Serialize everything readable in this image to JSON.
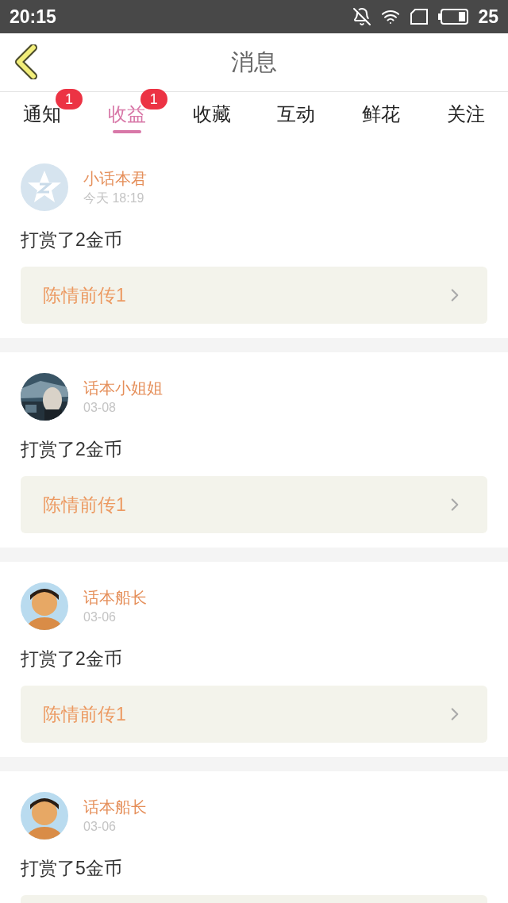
{
  "status_bar": {
    "time": "20:15",
    "battery": "25"
  },
  "header": {
    "title": "消息"
  },
  "tabs": [
    {
      "label": "通知",
      "selected": false,
      "badge": "1"
    },
    {
      "label": "收益",
      "selected": true,
      "badge": "1"
    },
    {
      "label": "收藏",
      "selected": false
    },
    {
      "label": "互动",
      "selected": false
    },
    {
      "label": "鲜花",
      "selected": false
    },
    {
      "label": "关注",
      "selected": false
    }
  ],
  "messages": [
    {
      "avatar": {
        "kind": "star"
      },
      "name": "小话本君",
      "time": "今天 18:19",
      "text": "打赏了2金币",
      "link": "陈情前传1"
    },
    {
      "name": "话本小姐姐",
      "time": "03-08",
      "text": "打赏了2金币",
      "link": "陈情前传1"
    },
    {
      "avatar": {
        "kind": "figure"
      },
      "name": "话本船长",
      "time": "03-06",
      "text": "打赏了2金币",
      "link": "陈情前传1"
    },
    {
      "avatar": {
        "kind": "figure"
      },
      "name": "话本船长",
      "time": "03-06",
      "text": "打赏了5金币"
    }
  ]
}
